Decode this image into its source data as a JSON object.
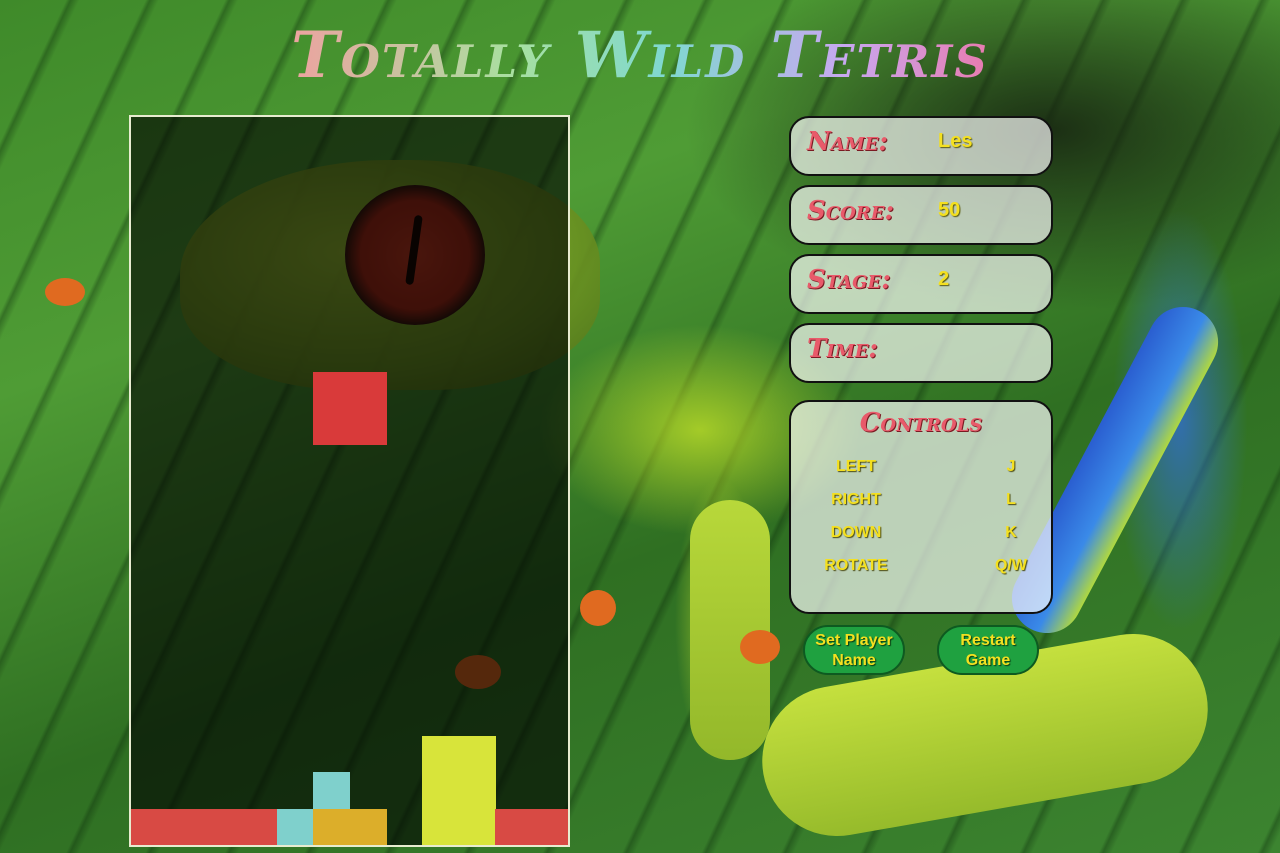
{
  "title": "Totally Wild Tetris",
  "player": {
    "name_label": "Name:",
    "name_value": "Les",
    "score_label": "Score:",
    "score_value": "50",
    "stage_label": "Stage:",
    "stage_value": "2",
    "time_label": "Time:",
    "time_value": ""
  },
  "controls": {
    "title": "Controls",
    "rows": [
      {
        "action": "LEFT",
        "key": "J"
      },
      {
        "action": "RIGHT",
        "key": "L"
      },
      {
        "action": "DOWN",
        "key": "K"
      },
      {
        "action": "ROTATE",
        "key": "Q/W"
      }
    ]
  },
  "buttons": {
    "set_player_name": "Set Player Name",
    "restart_game": "Restart Game"
  },
  "board": {
    "columns": 12,
    "rows": 20,
    "falling_piece": {
      "color": "#d93a3a",
      "cells": [
        [
          5,
          7
        ],
        [
          6,
          7
        ],
        [
          5,
          8
        ],
        [
          6,
          8
        ]
      ]
    },
    "locked_cells": [
      {
        "col": 0,
        "row": 19,
        "color": "#d84a44"
      },
      {
        "col": 1,
        "row": 19,
        "color": "#d84a44"
      },
      {
        "col": 2,
        "row": 19,
        "color": "#d84a44"
      },
      {
        "col": 3,
        "row": 19,
        "color": "#d84a44"
      },
      {
        "col": 4,
        "row": 19,
        "color": "#7fd0cc"
      },
      {
        "col": 5,
        "row": 18,
        "color": "#7fd0cc"
      },
      {
        "col": 5,
        "row": 19,
        "color": "#dcae2a"
      },
      {
        "col": 6,
        "row": 19,
        "color": "#dcae2a"
      },
      {
        "col": 8,
        "row": 17,
        "color": "#d8e43a"
      },
      {
        "col": 9,
        "row": 17,
        "color": "#d8e43a"
      },
      {
        "col": 8,
        "row": 18,
        "color": "#d8e43a"
      },
      {
        "col": 9,
        "row": 18,
        "color": "#d8e43a"
      },
      {
        "col": 8,
        "row": 19,
        "color": "#d8e43a"
      },
      {
        "col": 9,
        "row": 19,
        "color": "#d8e43a"
      },
      {
        "col": 10,
        "row": 19,
        "color": "#d84a44"
      },
      {
        "col": 11,
        "row": 19,
        "color": "#d84a44"
      }
    ]
  }
}
